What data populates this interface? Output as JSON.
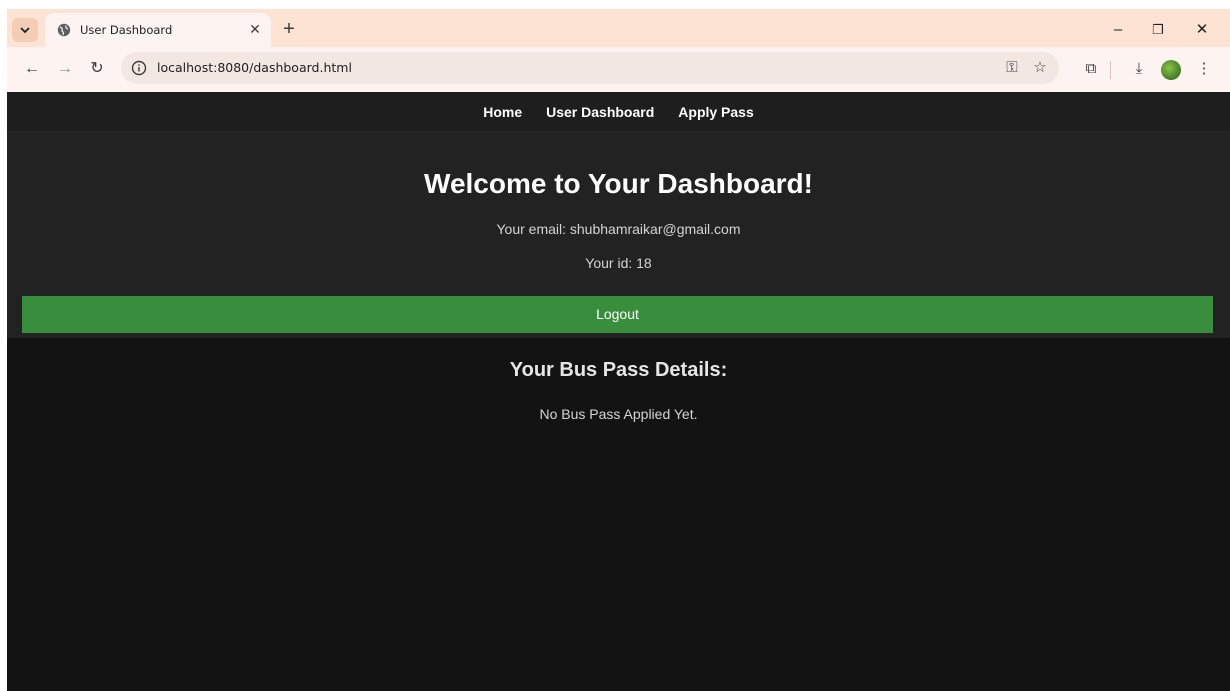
{
  "browser": {
    "tab_title": "User Dashboard",
    "tab_close_glyph": "✕",
    "new_tab_glyph": "+",
    "url": "localhost:8080/dashboard.html",
    "window_controls": {
      "minimize": "–",
      "restore": "❐",
      "close": "✕"
    },
    "nav_glyphs": {
      "back": "←",
      "forward": "→",
      "reload": "↻"
    },
    "omnibox_icons": {
      "passkey": "⚿",
      "bookmark": "☆"
    },
    "toolbar_glyphs": {
      "extensions": "⧉",
      "download": "⤓",
      "menu": "⋮"
    },
    "icons": [
      "chevron-down-icon",
      "globe-icon",
      "info-icon",
      "key-icon",
      "star-icon",
      "puzzle-icon",
      "download-icon",
      "more-vert-icon"
    ]
  },
  "nav": {
    "items": [
      {
        "label": "Home"
      },
      {
        "label": "User Dashboard"
      },
      {
        "label": "Apply Pass"
      }
    ]
  },
  "dashboard": {
    "title": "Welcome to Your Dashboard!",
    "email_text": "Your email: shubhamraikar@gmail.com",
    "id_text": "Your id: 18",
    "logout_label": "Logout"
  },
  "bus_pass": {
    "title": "Your Bus Pass Details:",
    "status": "No Bus Pass Applied Yet."
  },
  "colors": {
    "page_bg": "#131313",
    "panel_bg": "#222222",
    "nav_bg": "#1e1e1e",
    "logout_green": "#388e3c",
    "browser_frame": "#fde3d4"
  }
}
